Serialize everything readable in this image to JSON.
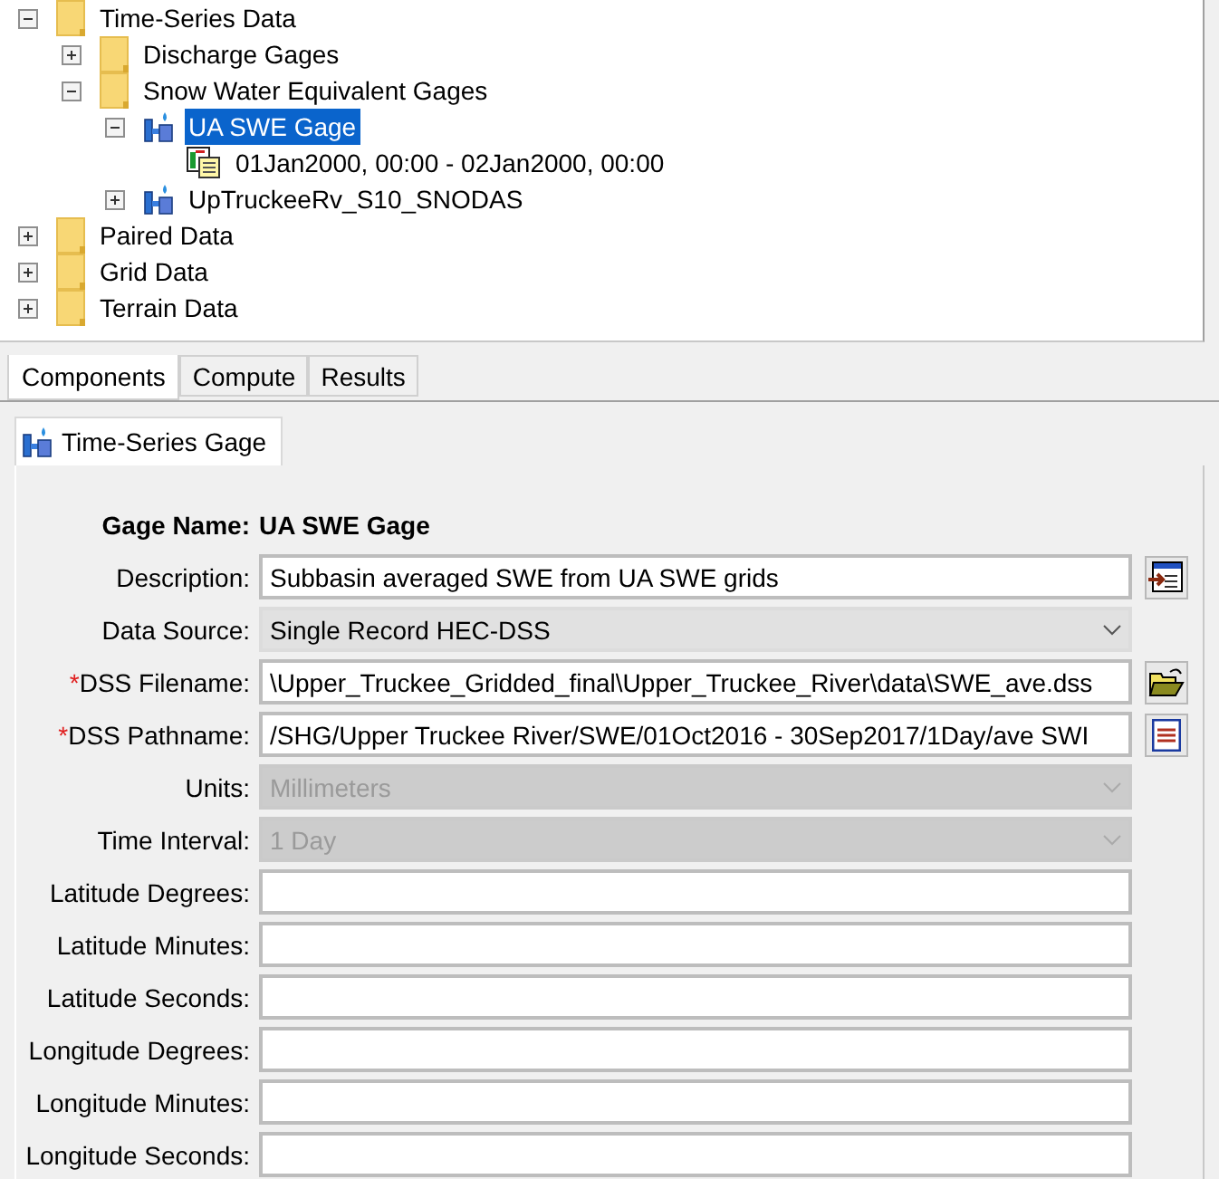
{
  "tree": [
    {
      "label": "Time-Series Data",
      "kind": "folder",
      "expanded": true,
      "selected": false,
      "children": [
        {
          "label": "Discharge Gages",
          "kind": "folder",
          "expanded": false,
          "selected": false
        },
        {
          "label": "Snow Water Equivalent Gages",
          "kind": "folder",
          "expanded": true,
          "selected": false,
          "children": [
            {
              "label": "UA SWE Gage",
              "kind": "gage",
              "expanded": true,
              "selected": true,
              "children": [
                {
                  "label": "01Jan2000, 00:00 - 02Jan2000, 00:00",
                  "kind": "record",
                  "selected": false
                }
              ]
            },
            {
              "label": "UpTruckeeRv_S10_SNODAS",
              "kind": "gage",
              "expanded": false,
              "selected": false
            }
          ]
        }
      ]
    },
    {
      "label": "Paired Data",
      "kind": "folder",
      "expanded": false,
      "selected": false
    },
    {
      "label": "Grid Data",
      "kind": "folder",
      "expanded": false,
      "selected": false
    },
    {
      "label": "Terrain Data",
      "kind": "folder",
      "expanded": false,
      "selected": false
    }
  ],
  "tree_tabs": [
    {
      "label": "Components",
      "selected": true
    },
    {
      "label": "Compute",
      "selected": false
    },
    {
      "label": "Results",
      "selected": false
    }
  ],
  "editor_tab": {
    "label": "Time-Series Gage",
    "selected": true
  },
  "form": {
    "gage_name": {
      "label": "Gage Name:",
      "value": "UA SWE Gage"
    },
    "fields": [
      {
        "label": "Description:",
        "kind": "text",
        "value": "Subbasin averaged SWE from UA SWE grids",
        "disabled": false,
        "button": {
          "kind": "notes"
        }
      },
      {
        "label": "Data Source:",
        "kind": "select",
        "value": "Single Record HEC-DSS",
        "disabled": false
      },
      {
        "required_mark": "*",
        "label": "DSS Filename:",
        "kind": "text",
        "value": "\\Upper_Truckee_Gridded_final\\Upper_Truckee_River\\data\\SWE_ave.dss",
        "disabled": false,
        "button": {
          "kind": "open"
        }
      },
      {
        "required_mark": "*",
        "label": "DSS Pathname:",
        "kind": "text",
        "value": "/SHG/Upper Truckee River/SWE/01Oct2016 - 30Sep2017/1Day/ave SWI",
        "disabled": false,
        "button": {
          "kind": "list"
        }
      },
      {
        "label": "Units:",
        "kind": "select",
        "value": "Millimeters",
        "disabled": true
      },
      {
        "label": "Time Interval:",
        "kind": "select",
        "value": "1 Day",
        "disabled": true
      },
      {
        "label": "Latitude Degrees:",
        "kind": "text",
        "disabled": false
      },
      {
        "label": "Latitude Minutes:",
        "kind": "text",
        "disabled": false
      },
      {
        "label": "Latitude Seconds:",
        "kind": "text",
        "disabled": false
      },
      {
        "label": "Longitude Degrees:",
        "kind": "text",
        "disabled": false
      },
      {
        "label": "Longitude Minutes:",
        "kind": "text",
        "disabled": false
      },
      {
        "label": "Longitude Seconds:",
        "kind": "text",
        "disabled": false
      }
    ]
  }
}
